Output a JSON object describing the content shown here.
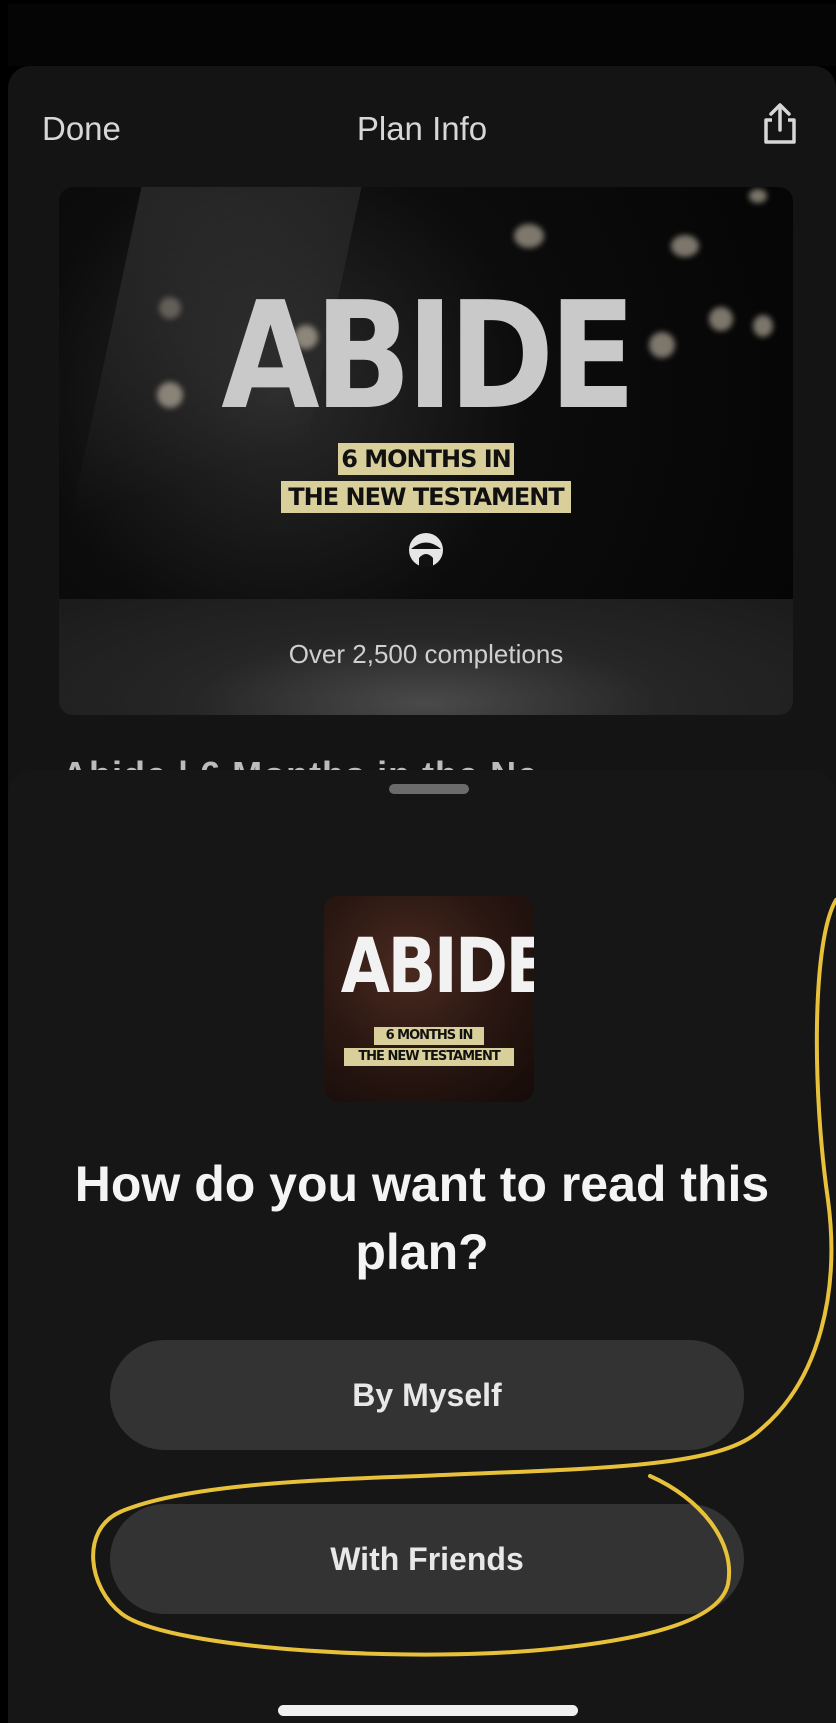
{
  "nav": {
    "done_label": "Done",
    "title": "Plan Info",
    "share_icon": "share-icon"
  },
  "hero": {
    "title": "ABIDE",
    "tag_line1": "6 MONTHS IN",
    "tag_line2": "THE NEW TESTAMENT",
    "completions": "Over 2,500 completions"
  },
  "partial_title": "Abide | 6 Months in the Ne",
  "sheet": {
    "thumb_title": "ABIDE",
    "thumb_tag_line1": "6 MONTHS IN",
    "thumb_tag_line2": "THE NEW TESTAMENT",
    "question": "How do you want to read this plan?",
    "options": [
      {
        "label": "By Myself"
      },
      {
        "label": "With Friends"
      }
    ]
  },
  "colors": {
    "background": "#000000",
    "sheet": "#161616",
    "button": "#333333",
    "tag": "#d9cf9a",
    "annotation": "#e8c13a"
  }
}
